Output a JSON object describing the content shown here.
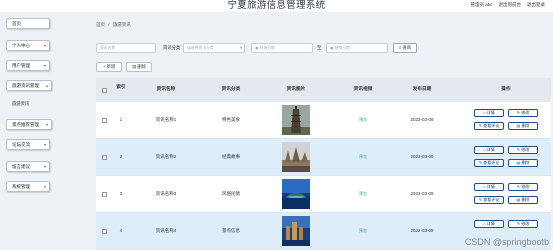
{
  "header": {
    "title": "宁夏旅游信息管理系统",
    "admin_label": "管理员 abc",
    "home_link": "退出到前台",
    "logout_link": "退出登录"
  },
  "sidebar": {
    "items": [
      {
        "label": "首页"
      },
      {
        "label": "个人中心"
      },
      {
        "label": "用户管理"
      },
      {
        "label": "旅游资讯管理"
      },
      {
        "label": "景点推荐管理"
      },
      {
        "label": "论坛交流"
      },
      {
        "label": "留言建议"
      },
      {
        "label": "系统管理"
      }
    ],
    "sub_items": [
      {
        "label": "旅游资讯"
      }
    ],
    "chevron": "▾"
  },
  "breadcrumb": {
    "home": "首页",
    "sep": "/",
    "current": "旅游资讯"
  },
  "search": {
    "name_placeholder": "资讯名称",
    "category_label": "资讯分类",
    "category_placeholder": "请选择资讯分类",
    "start_placeholder": "开始日期",
    "range_sep": "至",
    "end_placeholder": "结束日期",
    "query_label": "查询"
  },
  "actions": {
    "add_label": "新增",
    "delete_label": "删除"
  },
  "table": {
    "headers": [
      "索引",
      "资讯名称",
      "资讯分类",
      "资讯图片",
      "资讯视频",
      "发布日期",
      "操作"
    ],
    "rows": [
      {
        "index": "1",
        "name": "资讯名称1",
        "category": "特色美食",
        "video": "预览",
        "date": "2022-03-09",
        "image_icon": "tower-photo"
      },
      {
        "index": "2",
        "name": "资讯名称2",
        "category": "经典故事",
        "video": "预览",
        "date": "2022-03-09",
        "image_icon": "ruins-photo"
      },
      {
        "index": "3",
        "name": "资讯名称3",
        "category": "风俗民情",
        "video": "预览",
        "date": "2022-03-09",
        "image_icon": "island-photo"
      },
      {
        "index": "4",
        "name": "资讯名称4",
        "category": "景点信息",
        "video": "预览",
        "date": "2022-03-09",
        "image_icon": "city-photo"
      }
    ],
    "ops": {
      "detail": "详情",
      "edit": "修改",
      "comments": "查看评论",
      "delete": "删除"
    }
  },
  "watermark": "CSDN @springbootb"
}
